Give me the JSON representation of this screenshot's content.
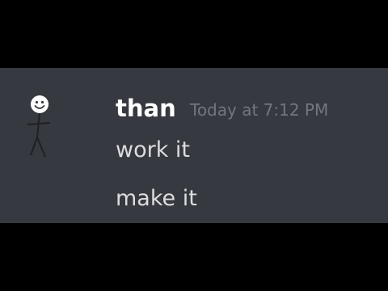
{
  "message_group": {
    "username": "than",
    "timestamp": "Today at 7:12 PM",
    "avatar_icon": "stick-figure-smiley-icon",
    "messages": [
      {
        "text": "work it"
      },
      {
        "text": "make it"
      }
    ]
  },
  "colors": {
    "background": "#36393f",
    "letterbox": "#000000",
    "username": "#ffffff",
    "timestamp": "#72767d",
    "message_text": "#dcddde"
  }
}
